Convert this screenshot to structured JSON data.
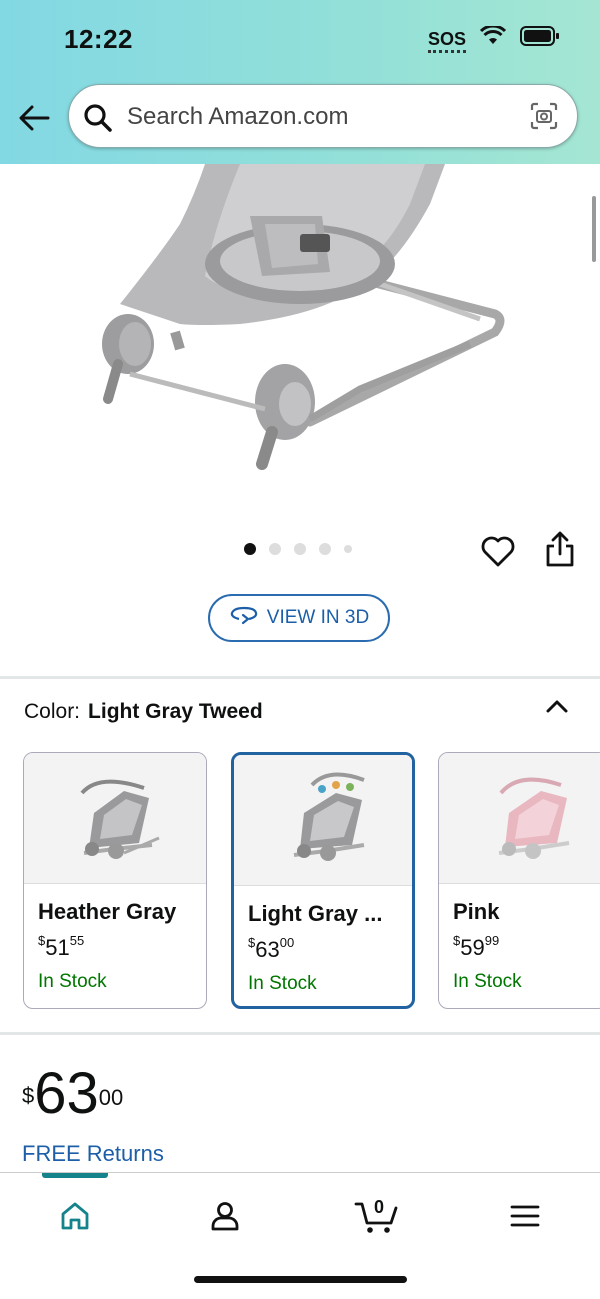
{
  "status_bar": {
    "time": "12:22",
    "sos": "SOS"
  },
  "search": {
    "placeholder": "Search Amazon.com"
  },
  "gallery": {
    "view_3d_label": "VIEW IN 3D"
  },
  "color": {
    "label": "Color:",
    "selected": "Light Gray Tweed"
  },
  "swatches": [
    {
      "name": "Heather Gray",
      "price_currency": "$",
      "price_dollars": "51",
      "price_cents": "55",
      "stock": "In Stock"
    },
    {
      "name": "Light Gray ...",
      "price_currency": "$",
      "price_dollars": "63",
      "price_cents": "00",
      "stock": "In Stock"
    },
    {
      "name": "Pink",
      "price_currency": "$",
      "price_dollars": "59",
      "price_cents": "99",
      "stock": "In Stock"
    }
  ],
  "price": {
    "currency": "$",
    "dollars": "63",
    "cents": "00"
  },
  "free_returns": "FREE Returns",
  "nav": {
    "cart_count": "0"
  },
  "colors": {
    "accent_blue": "#1c5fa8",
    "stock_green": "#007600",
    "nav_teal": "#15838c"
  }
}
